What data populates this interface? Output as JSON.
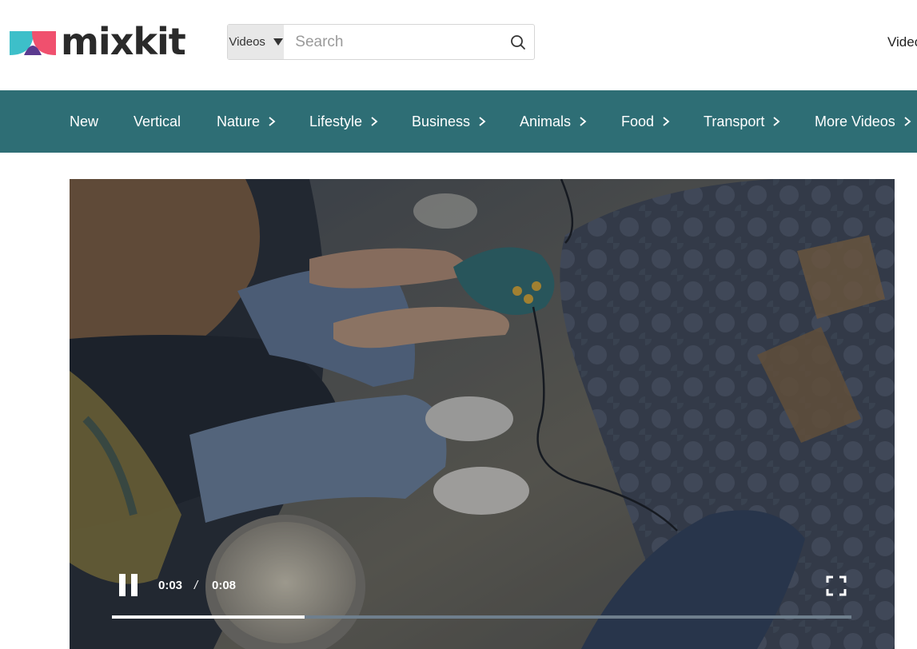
{
  "header": {
    "logo_text": "mixkit",
    "search": {
      "type_label": "Videos",
      "placeholder": "Search",
      "value": ""
    },
    "top_link": "Videos"
  },
  "nav": {
    "items": [
      {
        "label": "New",
        "has_chevron": false
      },
      {
        "label": "Vertical",
        "has_chevron": false
      },
      {
        "label": "Nature",
        "has_chevron": true
      },
      {
        "label": "Lifestyle",
        "has_chevron": true
      },
      {
        "label": "Business",
        "has_chevron": true
      },
      {
        "label": "Animals",
        "has_chevron": true
      },
      {
        "label": "Food",
        "has_chevron": true
      },
      {
        "label": "Transport",
        "has_chevron": true
      },
      {
        "label": "More Videos",
        "has_chevron": true
      }
    ]
  },
  "player": {
    "current_time": "0:03",
    "separator": "/",
    "duration": "0:08",
    "progress_fraction": 0.26,
    "state": "playing"
  },
  "colors": {
    "nav_bg": "#2e6e75",
    "logo_teal": "#3dbfc9",
    "logo_pink": "#f0506e",
    "logo_purple": "#5b3a8f",
    "logo_yellow": "#f5b323"
  },
  "icons": {
    "search": "search-icon",
    "dropdown": "caret-down-icon",
    "nav_chevron": "chevron-right-icon",
    "pause": "pause-icon",
    "fullscreen": "fullscreen-icon"
  }
}
